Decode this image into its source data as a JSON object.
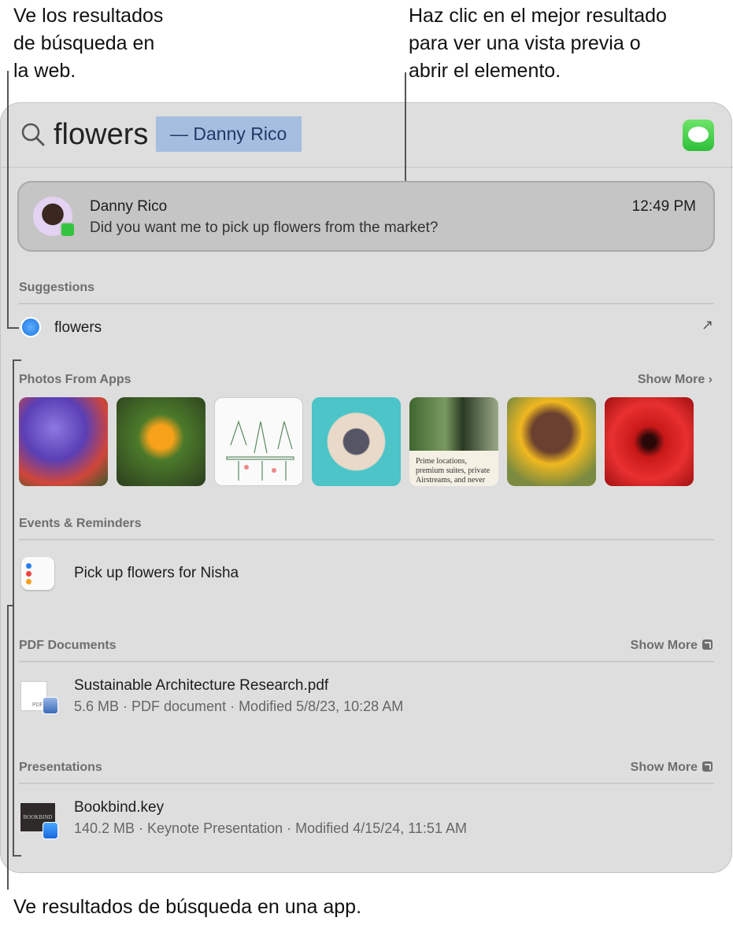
{
  "callouts": {
    "web": [
      "Ve los resultados",
      "de búsqueda en",
      "la web."
    ],
    "top_hit": [
      "Haz clic en el mejor resultado",
      "para ver una vista previa o",
      "abrir el elemento."
    ],
    "app": "Ve resultados de búsqueda en una app."
  },
  "search": {
    "query": "flowers",
    "completion": "— Danny Rico",
    "app_icon": "messages-icon"
  },
  "top_hit": {
    "name": "Danny Rico",
    "time": "12:49 PM",
    "message": "Did you want me to pick up flowers from the market?"
  },
  "suggestions": {
    "header": "Suggestions",
    "items": [
      {
        "label": "flowers",
        "icon": "safari-icon"
      }
    ]
  },
  "photos": {
    "header": "Photos From Apps",
    "show_more": "Show More",
    "doc_text": "Prime locations, premium suites, private Airstreams, and never"
  },
  "events": {
    "header": "Events & Reminders",
    "items": [
      {
        "title": "Pick up flowers for Nisha",
        "icon": "reminders-icon"
      }
    ]
  },
  "pdfs": {
    "header": "PDF Documents",
    "show_more": "Show More",
    "items": [
      {
        "name": "Sustainable Architecture Research.pdf",
        "meta": "5.6 MB · PDF document · Modified 5/8/23, 10:28 AM",
        "icon_label": "PDF"
      }
    ]
  },
  "presentations": {
    "header": "Presentations",
    "show_more": "Show More",
    "items": [
      {
        "name": "Bookbind.key",
        "meta": "140.2 MB · Keynote Presentation · Modified 4/15/24, 11:51 AM",
        "thumb_label": "BOOKBIND"
      }
    ]
  }
}
